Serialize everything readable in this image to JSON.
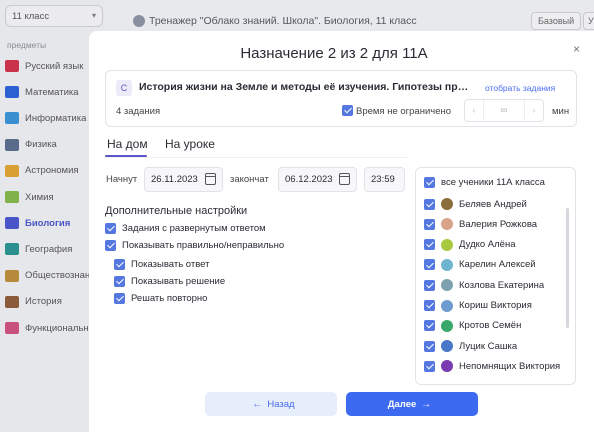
{
  "background": {
    "class_select": "11 класс",
    "subjects_title": "предметы",
    "subjects": [
      {
        "label": "Русский язык",
        "color": "#c8324b"
      },
      {
        "label": "Математика",
        "color": "#2d5fd2"
      },
      {
        "label": "Информатика",
        "color": "#3a8fd0"
      },
      {
        "label": "Физика",
        "color": "#5a6b8a"
      },
      {
        "label": "Астрономия",
        "color": "#d8a030"
      },
      {
        "label": "Химия",
        "color": "#7fb34a"
      },
      {
        "label": "Биология",
        "color": "#4a55c8"
      },
      {
        "label": "География",
        "color": "#2c8f8f"
      },
      {
        "label": "Обществознание",
        "color": "#b58a3a"
      },
      {
        "label": "История",
        "color": "#8a5a3a"
      },
      {
        "label": "Функциональная",
        "color": "#c94f7c"
      }
    ],
    "page_title": "Тренажер \"Облако знаний. Школа\". Биология, 11 класс",
    "level_pill": "Базовый",
    "level_pill2": "У"
  },
  "modal": {
    "title": "Назначение 2 из 2 для 11А",
    "close": "×",
    "topic": {
      "badge": "С",
      "title": "История жизни на Земле и методы её изучения. Гипотезы происхождения жизни",
      "select_link": "отобрать задания",
      "tasks_count": "4 задания",
      "time_label": "Время не ограничено",
      "time_value": "∞",
      "time_unit": "мин"
    },
    "tabs": [
      "На дом",
      "На уроке"
    ],
    "start_label": "Начнут",
    "start_date": "26.11.2023",
    "end_label": "закончат",
    "end_date": "06.12.2023",
    "end_time": "23:59",
    "settings_title": "Дополнительные настройки",
    "options": [
      "Задания с развернутым ответом",
      "Показывать правильно/неправильно",
      "Показывать ответ",
      "Показывать решение",
      "Решать повторно"
    ],
    "students_head": "все ученики 11А класса",
    "students": [
      {
        "name": "Беляев Андрей",
        "color": "#8a6d3b"
      },
      {
        "name": "Валерия Рожкова",
        "color": "#d9a38a"
      },
      {
        "name": "Дудко Алёна",
        "color": "#a8c840"
      },
      {
        "name": "Карелин Алексей",
        "color": "#6fb5d0"
      },
      {
        "name": "Козлова Екатерина",
        "color": "#7fa0b0"
      },
      {
        "name": "Кориш Виктория",
        "color": "#6e9bd0"
      },
      {
        "name": "Кротов Семён",
        "color": "#3aa86b"
      },
      {
        "name": "Луцик Сашка",
        "color": "#4a78c8"
      },
      {
        "name": "Непомнящих Виктория",
        "color": "#7a3ab0"
      }
    ],
    "back_label": "Назад",
    "next_label": "Далее"
  }
}
